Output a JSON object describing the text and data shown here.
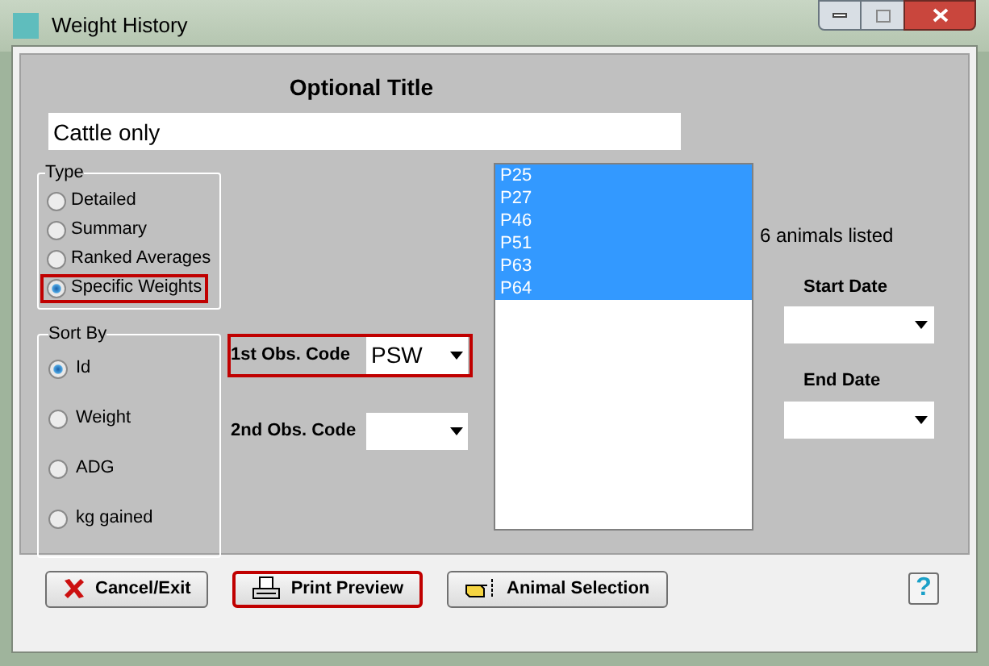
{
  "window": {
    "title": "Weight History"
  },
  "optional_title": {
    "label": "Optional Title",
    "value": "Cattle only"
  },
  "type_group": {
    "label": "Type",
    "options": [
      {
        "label": "Detailed",
        "selected": false,
        "highlighted": false
      },
      {
        "label": "Summary",
        "selected": false,
        "highlighted": false
      },
      {
        "label": "Ranked Averages",
        "selected": false,
        "highlighted": false
      },
      {
        "label": "Specific Weights",
        "selected": true,
        "highlighted": true
      }
    ]
  },
  "sort_group": {
    "label": "Sort By",
    "options": [
      {
        "label": "Id",
        "selected": true
      },
      {
        "label": "Weight",
        "selected": false
      },
      {
        "label": "ADG",
        "selected": false
      },
      {
        "label": "kg gained",
        "selected": false
      }
    ]
  },
  "obs_codes": [
    {
      "label": "1st Obs. Code",
      "value": "PSW",
      "highlighted": true
    },
    {
      "label": "2nd Obs. Code",
      "highlighted": false
    }
  ],
  "animal_list": [
    {
      "label": "P25",
      "selected": true
    },
    {
      "label": "P27",
      "selected": true
    },
    {
      "label": "P46",
      "selected": true
    },
    {
      "label": "P51",
      "selected": true
    },
    {
      "label": "P63",
      "selected": true
    },
    {
      "label": "P64",
      "selected": true
    }
  ],
  "count_text": "6 animals listed",
  "dates": [
    {
      "label": "Start Date"
    },
    {
      "label": "End Date"
    }
  ],
  "buttons": [
    {
      "kind": "cancel",
      "label": "Cancel/Exit",
      "highlighted": false
    },
    {
      "kind": "print",
      "label": "Print Preview",
      "highlighted": true
    },
    {
      "kind": "select",
      "label": "Animal Selection",
      "highlighted": false
    },
    {
      "kind": "help",
      "label": "?",
      "highlighted": false
    }
  ]
}
